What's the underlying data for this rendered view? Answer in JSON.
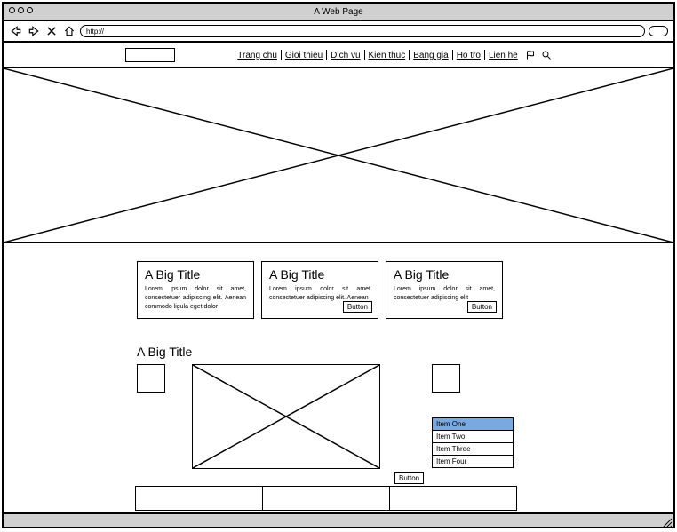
{
  "window": {
    "title": "A Web Page"
  },
  "url": "http://",
  "nav": {
    "items": [
      "Trang chu",
      "Gioi thieu",
      "Dich vu",
      "Kien thuc",
      "Bang gia",
      "Ho tro",
      "Lien he"
    ]
  },
  "cards": [
    {
      "title": "A Big Title",
      "text": "Lorem ipsum dolor sit amet, consectetuer adipiscing elit. Aenean commodo ligula eget dolor"
    },
    {
      "title": "A Big Title",
      "text": "Lorem ipsum dolor sit amet consectetuer adipiscing elit. Aenean",
      "button": "Button"
    },
    {
      "title": "A Big Title",
      "text": "Lorem ipsum dolor sit amet, consectetuer adipiscing elit",
      "button": "Button"
    }
  ],
  "section": {
    "title": "A Big Title",
    "button": "Button"
  },
  "list": {
    "items": [
      "Item One",
      "Item Two",
      "Item Three",
      "Item Four"
    ],
    "selected": 0
  }
}
